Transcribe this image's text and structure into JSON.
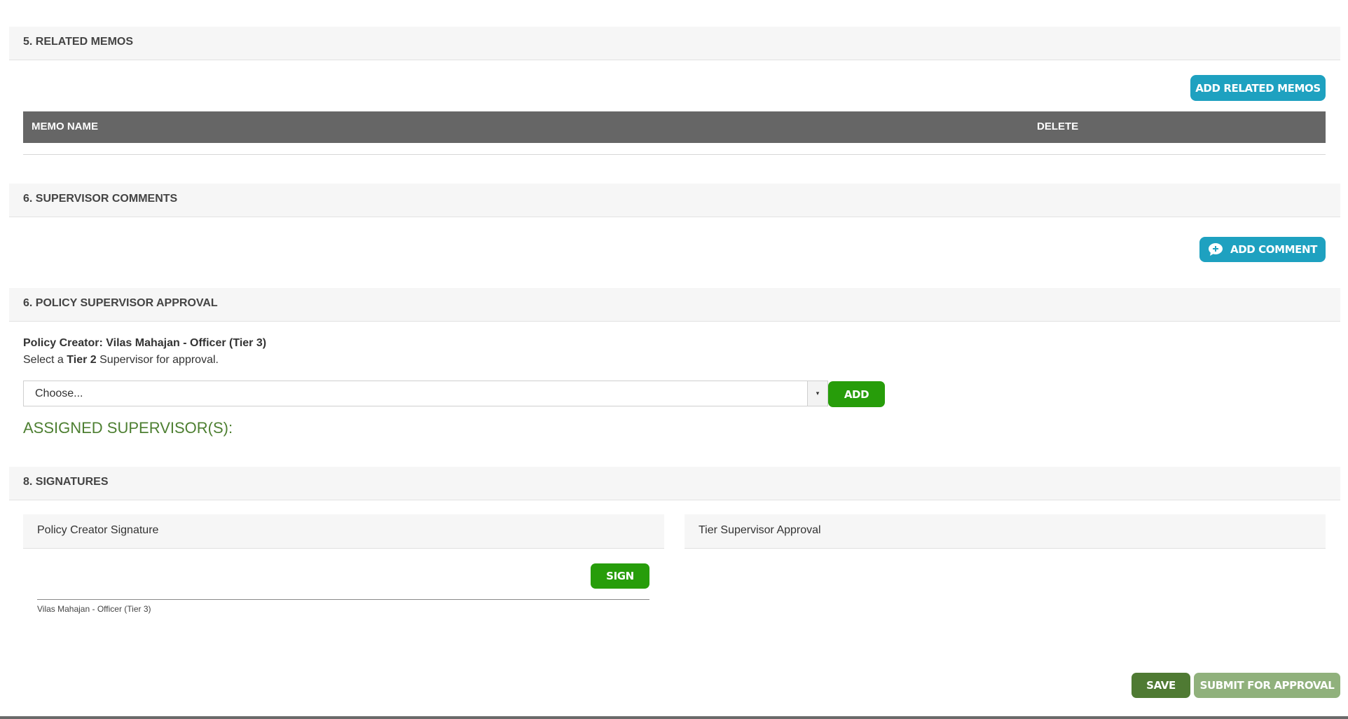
{
  "related_memos": {
    "title": "5. RELATED MEMOS",
    "add_button": "ADD RELATED MEMOS",
    "columns": [
      "MEMO NAME",
      "DELETE"
    ],
    "rows": []
  },
  "supervisor_comments": {
    "title": "6. SUPERVISOR COMMENTS",
    "add_button": "ADD COMMENT"
  },
  "policy_approval": {
    "title": "6. POLICY SUPERVISOR APPROVAL",
    "creator_label": "Policy Creator: Vilas Mahajan - Officer (Tier 3)",
    "instruction_prefix": "Select a ",
    "instruction_tier": "Tier 2",
    "instruction_suffix": " Supervisor for approval.",
    "select_value": "Choose...",
    "add_button": "ADD",
    "assigned_label": "ASSIGNED SUPERVISOR(S):"
  },
  "signatures": {
    "title": "8. SIGNATURES",
    "creator_box_title": "Policy Creator Signature",
    "sign_button": "SIGN",
    "creator_name": "Vilas Mahajan - Officer (Tier 3)",
    "supervisor_box_title": "Tier Supervisor Approval"
  },
  "footer": {
    "save_button": "SAVE",
    "submit_button": "SUBMIT FOR APPROVAL"
  },
  "colors": {
    "teal": "#1ea1c0",
    "green": "#279d0a",
    "dark_green": "#4f7a33",
    "light_green": "#90b17c",
    "table_header": "#666666"
  }
}
